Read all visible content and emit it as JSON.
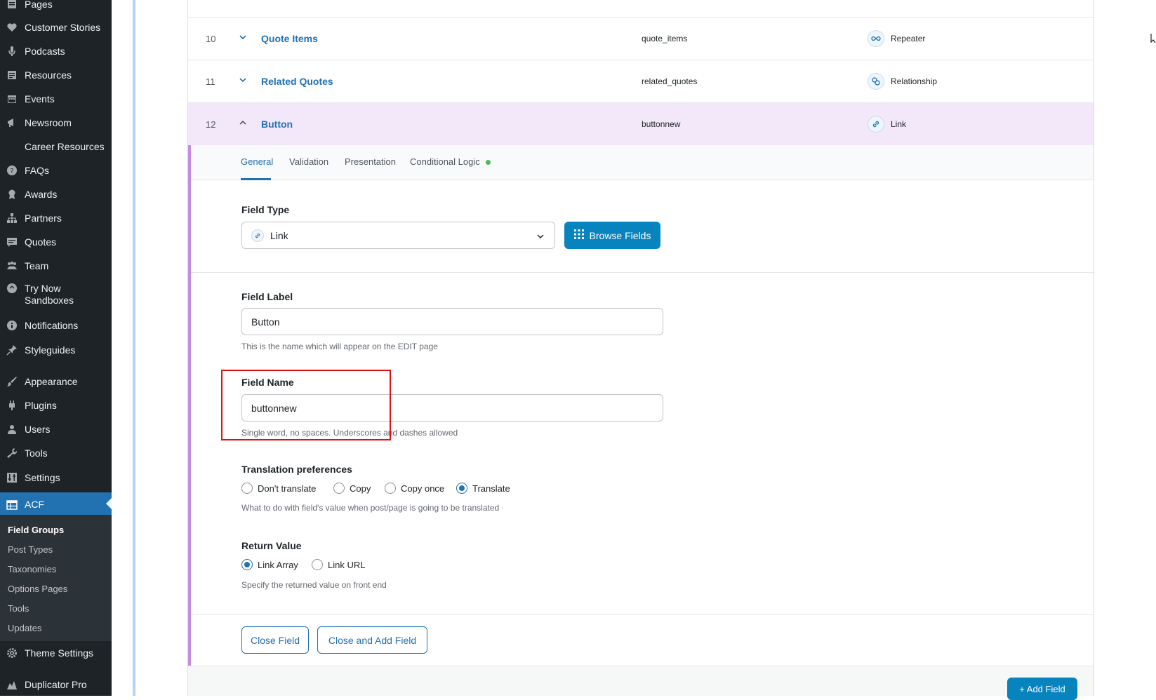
{
  "sidebar": {
    "items": [
      {
        "label": "Pages",
        "icon": "pages-icon"
      },
      {
        "label": "Customer Stories",
        "icon": "heart-icon"
      },
      {
        "label": "Podcasts",
        "icon": "microphone-icon"
      },
      {
        "label": "Resources",
        "icon": "document-icon"
      },
      {
        "label": "Events",
        "icon": "calendar-icon"
      },
      {
        "label": "Newsroom",
        "icon": "megaphone-icon"
      },
      {
        "label": "Career Resources",
        "icon": ""
      },
      {
        "label": "FAQs",
        "icon": "help-icon"
      },
      {
        "label": "Awards",
        "icon": "award-icon"
      },
      {
        "label": "Partners",
        "icon": "sitemap-icon"
      },
      {
        "label": "Quotes",
        "icon": "quote-icon"
      },
      {
        "label": "Team",
        "icon": "groups-icon"
      },
      {
        "label": "Try Now Sandboxes",
        "icon": "sandbox-icon"
      },
      {
        "label": "Notifications",
        "icon": "info-icon"
      },
      {
        "label": "Styleguides",
        "icon": "pin-icon"
      },
      {
        "label": "Appearance",
        "icon": "brush-icon"
      },
      {
        "label": "Plugins",
        "icon": "plugin-icon"
      },
      {
        "label": "Users",
        "icon": "user-icon"
      },
      {
        "label": "Tools",
        "icon": "wrench-icon"
      },
      {
        "label": "Settings",
        "icon": "settings-icon"
      },
      {
        "label": "ACF",
        "icon": "table-icon"
      }
    ],
    "submenu": [
      "Field Groups",
      "Post Types",
      "Taxonomies",
      "Options Pages",
      "Tools",
      "Updates"
    ],
    "bottom_items": [
      "Theme Settings",
      "Duplicator Pro"
    ]
  },
  "fields": [
    {
      "num": "10",
      "label": "Quote Items",
      "key": "quote_items",
      "type": "Repeater",
      "type_icon": "infinity-icon"
    },
    {
      "num": "11",
      "label": "Related Quotes",
      "key": "related_quotes",
      "type": "Relationship",
      "type_icon": "relationship-icon"
    },
    {
      "num": "12",
      "label": "Button",
      "key": "buttonnew",
      "type": "Link",
      "type_icon": "link-icon"
    }
  ],
  "tabs": [
    "General",
    "Validation",
    "Presentation",
    "Conditional Logic"
  ],
  "form": {
    "field_type_label": "Field Type",
    "field_type_value": "Link",
    "browse_label": "Browse Fields",
    "field_label_label": "Field Label",
    "field_label_value": "Button",
    "field_label_help": "This is the name which will appear on the EDIT page",
    "field_name_label": "Field Name",
    "field_name_value": "buttonnew",
    "field_name_help": "Single word, no spaces. Underscores and dashes allowed",
    "translation_label": "Translation preferences",
    "translation_options": [
      "Don't translate",
      "Copy",
      "Copy once",
      "Translate"
    ],
    "translation_selected": "Translate",
    "translation_help": "What to do with field's value when post/page is going to be translated",
    "return_label": "Return Value",
    "return_options": [
      "Link Array",
      "Link URL"
    ],
    "return_selected": "Link Array",
    "return_help": "Specify the returned value on front end"
  },
  "footer": {
    "close_field": "Close Field",
    "close_add": "Close and Add Field",
    "add_field": "+ Add Field"
  },
  "colors": {
    "accent": "#2271b1",
    "primary_button": "#0783be",
    "sidebar_bg": "#1d2327",
    "highlight": "#e01010"
  }
}
